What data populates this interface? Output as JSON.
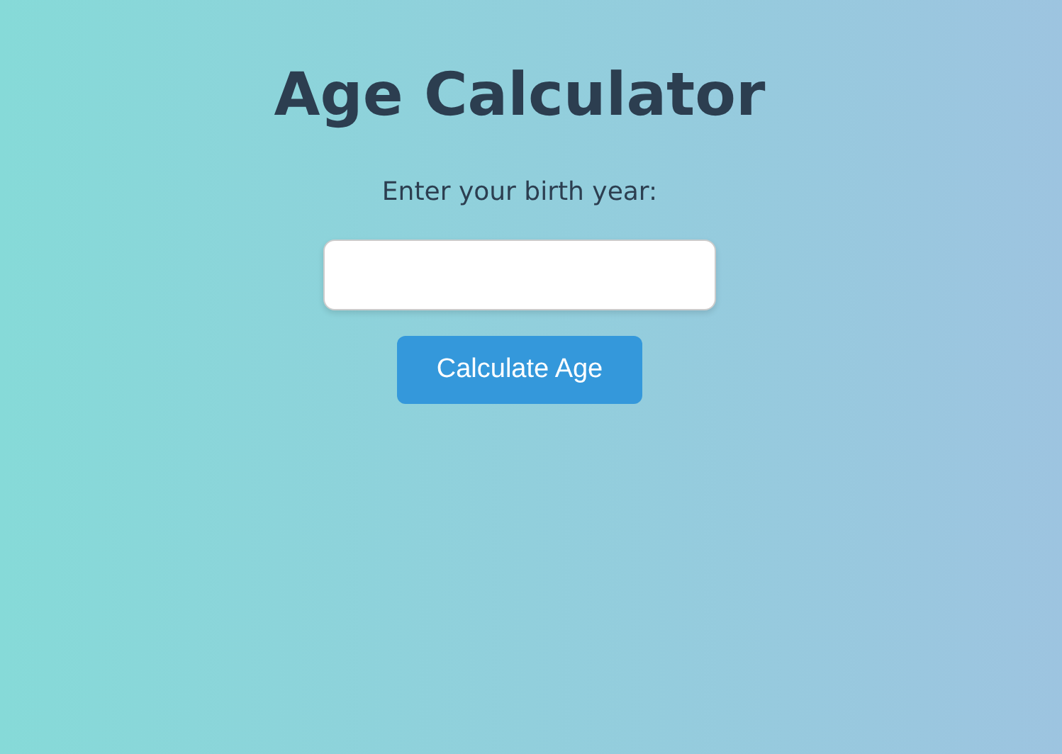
{
  "title": "Age Calculator",
  "prompt": "Enter your birth year:",
  "button": {
    "label": "Calculate Age"
  }
}
